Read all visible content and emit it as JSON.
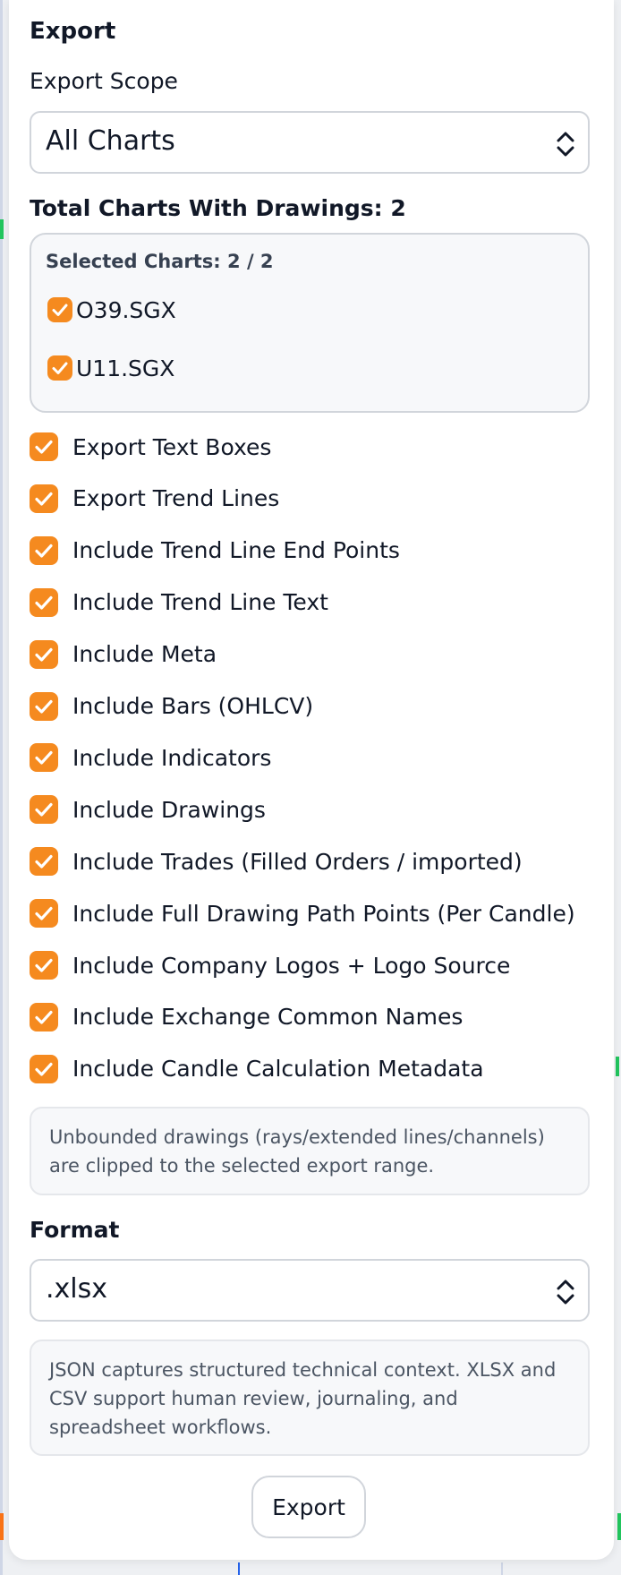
{
  "panel": {
    "title": "Export",
    "scope_label": "Export Scope",
    "scope_value": "All Charts",
    "total_label": "Total Charts With Drawings: 2",
    "selected_count": "Selected Charts: 2 / 2",
    "charts": [
      {
        "name": "O39.SGX",
        "checked": true
      },
      {
        "name": "U11.SGX",
        "checked": true
      }
    ],
    "options": [
      {
        "label": "Export Text Boxes",
        "checked": true
      },
      {
        "label": "Export Trend Lines",
        "checked": true
      },
      {
        "label": "Include Trend Line End Points",
        "checked": true
      },
      {
        "label": "Include Trend Line Text",
        "checked": true
      },
      {
        "label": "Include Meta",
        "checked": true
      },
      {
        "label": "Include Bars (OHLCV)",
        "checked": true
      },
      {
        "label": "Include Indicators",
        "checked": true
      },
      {
        "label": "Include Drawings",
        "checked": true
      },
      {
        "label": "Include Trades (Filled Orders / imported)",
        "checked": true
      },
      {
        "label": "Include Full Drawing Path Points (Per Candle)",
        "checked": true
      },
      {
        "label": "Include Company Logos + Logo Source",
        "checked": true
      },
      {
        "label": "Include Exchange Common Names",
        "checked": true
      },
      {
        "label": "Include Candle Calculation Metadata",
        "checked": true
      }
    ],
    "clip_note": "Unbounded drawings (rays/extended lines/channels) are clipped to the selected export range.",
    "format_label": "Format",
    "format_value": ".xlsx",
    "format_note": "JSON captures structured technical context. XLSX and CSV support human review, journaling, and spreadsheet workflows.",
    "export_button": "Export"
  },
  "colors": {
    "accent": "#f58a1f",
    "panel_bg": "#ffffff",
    "border": "#d1d5db"
  },
  "icons": {
    "select_chevron": "chevron-up-down-icon",
    "checkbox": "checkmark-icon"
  }
}
